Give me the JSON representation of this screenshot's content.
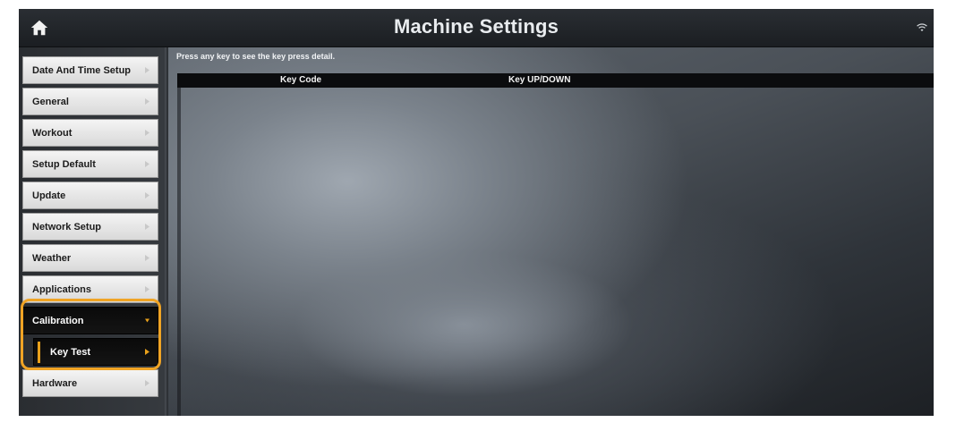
{
  "header": {
    "title": "Machine Settings",
    "home_icon": "home-icon",
    "wifi_icon": "wifi-icon"
  },
  "sidebar": {
    "items": [
      {
        "label": "Date And Time Setup"
      },
      {
        "label": "General"
      },
      {
        "label": "Workout"
      },
      {
        "label": "Setup Default"
      },
      {
        "label": "Update"
      },
      {
        "label": "Network Setup"
      },
      {
        "label": "Weather"
      },
      {
        "label": "Applications"
      },
      {
        "label": "Calibration",
        "active": true
      },
      {
        "label": "Key Test",
        "selected_subitem": true
      },
      {
        "label": "Hardware"
      }
    ]
  },
  "main": {
    "hint": "Press any key to see the key press detail.",
    "table": {
      "columns": [
        "Key Code",
        "Key UP/DOWN"
      ]
    }
  },
  "colors": {
    "accent_highlight": "#f0a425",
    "active_item_bg": "#0a0a0a",
    "item_bg": "#e8e8e8"
  }
}
